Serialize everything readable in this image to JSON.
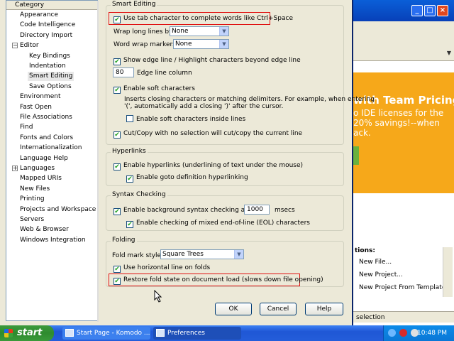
{
  "category": {
    "header": "Category",
    "items": [
      {
        "label": "Appearance",
        "level": 0,
        "expander": false,
        "selected": false
      },
      {
        "label": "Code Intelligence",
        "level": 0,
        "expander": false,
        "selected": false
      },
      {
        "label": "Directory Import",
        "level": 0,
        "expander": false,
        "selected": false
      },
      {
        "label": "Editor",
        "level": 0,
        "expander": true,
        "expander_glyph": "−",
        "selected": false
      },
      {
        "label": "Key Bindings",
        "level": 1,
        "expander": false,
        "selected": false
      },
      {
        "label": "Indentation",
        "level": 1,
        "expander": false,
        "selected": false
      },
      {
        "label": "Smart Editing",
        "level": 1,
        "expander": false,
        "selected": true
      },
      {
        "label": "Save Options",
        "level": 1,
        "expander": false,
        "selected": false
      },
      {
        "label": "Environment",
        "level": 0,
        "expander": false,
        "selected": false
      },
      {
        "label": "Fast Open",
        "level": 0,
        "expander": false,
        "selected": false
      },
      {
        "label": "File Associations",
        "level": 0,
        "expander": false,
        "selected": false
      },
      {
        "label": "Find",
        "level": 0,
        "expander": false,
        "selected": false
      },
      {
        "label": "Fonts and Colors",
        "level": 0,
        "expander": false,
        "selected": false
      },
      {
        "label": "Internationalization",
        "level": 0,
        "expander": false,
        "selected": false
      },
      {
        "label": "Language Help",
        "level": 0,
        "expander": false,
        "selected": false
      },
      {
        "label": "Languages",
        "level": 0,
        "expander": true,
        "expander_glyph": "+",
        "selected": false
      },
      {
        "label": "Mapped URIs",
        "level": 0,
        "expander": false,
        "selected": false
      },
      {
        "label": "New Files",
        "level": 0,
        "expander": false,
        "selected": false
      },
      {
        "label": "Printing",
        "level": 0,
        "expander": false,
        "selected": false
      },
      {
        "label": "Projects and Workspace",
        "level": 0,
        "expander": false,
        "selected": false
      },
      {
        "label": "Servers",
        "level": 0,
        "expander": false,
        "selected": false
      },
      {
        "label": "Web & Browser",
        "level": 0,
        "expander": false,
        "selected": false
      },
      {
        "label": "Windows Integration",
        "level": 0,
        "expander": false,
        "selected": false
      }
    ]
  },
  "smart_editing": {
    "title": "Smart Editing",
    "use_tab": {
      "label": "Use tab character to complete words like Ctrl+Space",
      "checked": true
    },
    "wrap_long_lines": {
      "label": "Wrap long lines by:",
      "value": "None"
    },
    "word_wrap_markers": {
      "label": "Word wrap markers:",
      "value": "None"
    },
    "show_edge_line": {
      "label": "Show edge line / Highlight characters beyond edge line",
      "checked": true
    },
    "edge_line_column": {
      "value": "80",
      "label": "Edge line column"
    },
    "soft_chars": {
      "label": "Enable soft characters",
      "checked": true
    },
    "soft_desc_1": "Inserts closing characters or matching delimiters. For example, when entering",
    "soft_desc_2": "'(', automatically add a closing ')' after the cursor.",
    "soft_inside_lines": {
      "label": "Enable soft characters inside lines",
      "checked": false
    },
    "cut_copy": {
      "label": "Cut/Copy with no selection will cut/copy the current line",
      "checked": true
    }
  },
  "hyperlinks": {
    "title": "Hyperlinks",
    "enable": {
      "label": "Enable hyperlinks (underlining of text under the mouse)",
      "checked": true
    },
    "goto_def": {
      "label": "Enable goto definition hyperlinking",
      "checked": true
    }
  },
  "syntax": {
    "title": "Syntax Checking",
    "background": {
      "label": "Enable background syntax checking after",
      "value": "1000",
      "unit": "msecs",
      "checked": true
    },
    "mixed_eol": {
      "label": "Enable checking of mixed end-of-line (EOL) characters",
      "checked": true
    }
  },
  "folding": {
    "title": "Folding",
    "fold_mark_style": {
      "label": "Fold mark style:",
      "value": "Square Trees"
    },
    "horizontal_line": {
      "label": "Use horizontal line on folds",
      "checked": true
    },
    "restore_state": {
      "label": "Restore fold state on document load (slows down file opening)",
      "checked": true
    }
  },
  "buttons": {
    "ok": "OK",
    "cancel": "Cancel",
    "help": "Help"
  },
  "background_app": {
    "banner_headline": "with Team Pricing",
    "banner_line1": "o IDE licenses for the",
    "banner_line2": "20% savings!--when",
    "banner_line3": "ack.",
    "actions_header": "tions:",
    "actions": [
      "New File...",
      "New Project...",
      "New Project From Template..."
    ],
    "status": "selection"
  },
  "taskbar": {
    "start": "start",
    "tasks": [
      "Start Page - Komodo ...",
      "Preferences"
    ],
    "clock": "10:48 PM"
  },
  "colors": {
    "highlight_box": "#e01010",
    "selected_category": "#e8e8e8",
    "taskbar": "#245dda",
    "start": "#2e8b2e"
  }
}
